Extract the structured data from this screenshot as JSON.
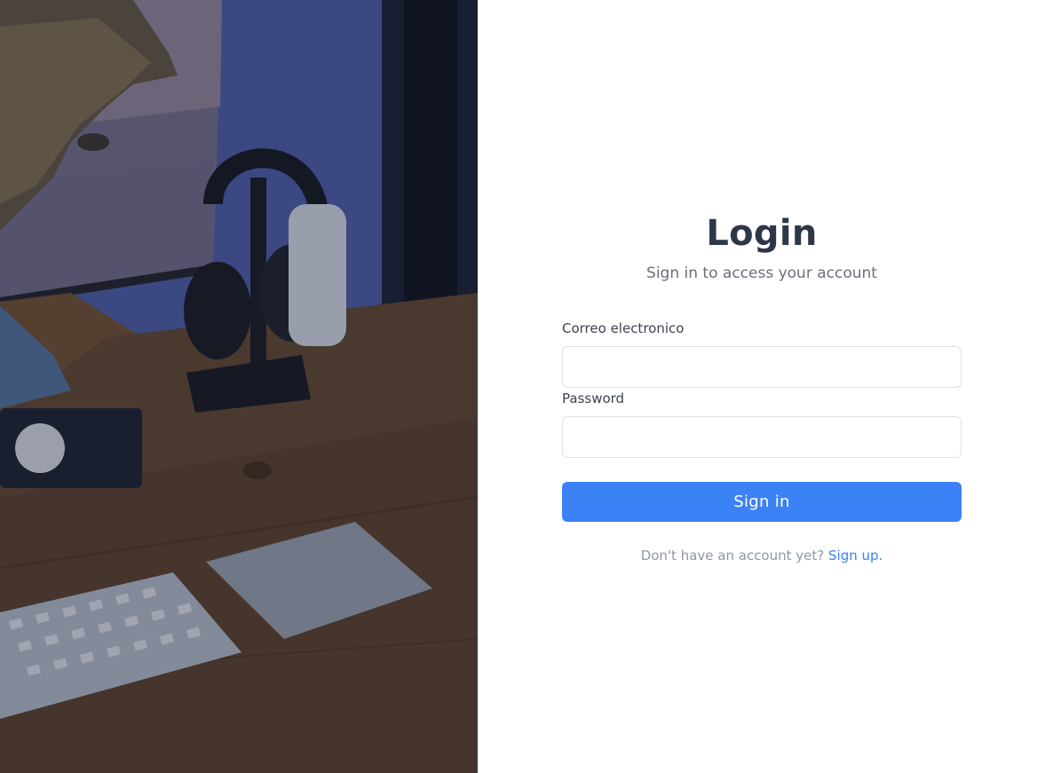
{
  "hero_image": {
    "description_icon": "desk-photo"
  },
  "login": {
    "title": "Login",
    "subtitle": "Sign in to access your account",
    "email_label": "Correo electronico",
    "email_value": "",
    "password_label": "Password",
    "password_value": "",
    "submit_label": "Sign in",
    "signup_prompt": "Don't have an account yet?",
    "signup_link": "Sign up."
  },
  "colors": {
    "primary": "#3b82f6",
    "title": "#2d3748",
    "muted": "#9097a3",
    "border": "#dde1e7"
  }
}
